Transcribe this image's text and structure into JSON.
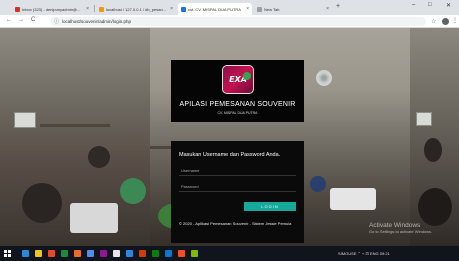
{
  "browser": {
    "tabs": [
      {
        "title": "Inbox (323) - denipunyadmin@...",
        "favicon": "#d93025",
        "active": false
      },
      {
        "title": "localhost / 127.0.0.1 / db_pesan...",
        "favicon": "#f29900",
        "active": false
      },
      {
        "title": "cst. CV. MISPAL DUA PUTRA",
        "favicon": "#1a73e8",
        "active": true
      },
      {
        "title": "New Tab",
        "favicon": "#9aa0a6",
        "active": false
      }
    ],
    "close_glyph": "×",
    "new_tab_glyph": "+",
    "window_controls": {
      "minimize": "–",
      "maximize": "□",
      "close": "✕"
    },
    "url": "localhost/souvenir/admin/login.php",
    "nav": {
      "back": "←",
      "forward": "→",
      "reload": "C",
      "info": "ⓘ"
    },
    "star_glyph": "☆",
    "menu_glyph": "⋮"
  },
  "brand": {
    "logo_text": "EXA",
    "title": "APILASI PEMESANAN SOUVENIR",
    "subtitle": "CV. MISPAL DUA PUTRA"
  },
  "form": {
    "prompt": "Masukan Username dan Password Anda.",
    "username_placeholder": "Username",
    "password_placeholder": "Password",
    "login_label": "LOGIN",
    "footer": "© 2020 - Aplikasi Pemesanan Souvenir - Sistem Jessie Pemula"
  },
  "watermark": {
    "line1": "Activate Windows",
    "line2": "Go to Settings to activate Windows."
  },
  "taskbar": {
    "tray_text": "SIMOUSE  ⌃  ⌁  ⊡  ENG  09:21",
    "icon_colors": [
      "#2b88d8",
      "#f0c419",
      "#e04b2c",
      "#1b8a3a",
      "#ec6b2a",
      "#4a8ff7",
      "#8d1b8f",
      "#e6e6e6",
      "#2b88d8",
      "#d83b01",
      "#107c10",
      "#0078d7",
      "#f25022",
      "#7fba00"
    ]
  },
  "colors": {
    "accent": "#16a89b",
    "card": "#0a0a0a",
    "logo": "#c4134f"
  }
}
